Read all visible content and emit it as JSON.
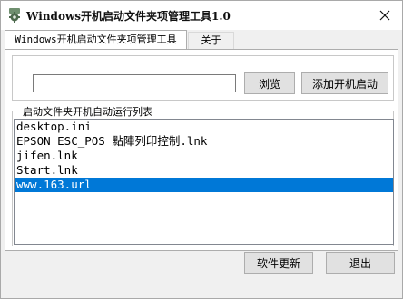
{
  "window": {
    "title": "Windows开机启动文件夹项管理工具1.0",
    "icons": {
      "app": "gear-icon",
      "close": "close-icon"
    }
  },
  "tabs": [
    {
      "label": "Windows开机启动文件夹项管理工具",
      "active": true
    },
    {
      "label": "关于",
      "active": false
    }
  ],
  "path_input": {
    "value": "",
    "placeholder": ""
  },
  "buttons": {
    "browse": "浏览",
    "add_startup": "添加开机启动",
    "update": "软件更新",
    "exit": "退出"
  },
  "list_group": {
    "caption": "启动文件夹开机自动运行列表",
    "items": [
      "desktop.ini",
      "EPSON ESC_POS 點陣列印控制.lnk",
      "jifen.lnk",
      "Start.lnk",
      "www.163.url"
    ],
    "selected_index": 4
  },
  "colors": {
    "selection": "#0078d7",
    "window_bg": "#f0f0f0"
  }
}
